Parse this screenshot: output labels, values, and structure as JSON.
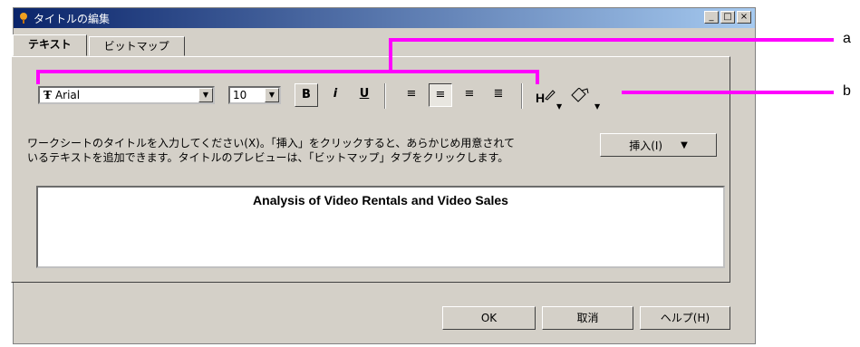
{
  "window": {
    "title": "タイトルの編集",
    "buttons": {
      "minimize": "_",
      "maximize": "□",
      "close": "×"
    }
  },
  "tabs": [
    {
      "label": "テキスト",
      "active": true
    },
    {
      "label": "ビットマップ",
      "active": false
    }
  ],
  "toolbar": {
    "font": "Arial",
    "size": "10",
    "bold": "B",
    "italic": "i",
    "underline": "U",
    "align_left": "≡",
    "align_center": "≡",
    "align_right": "≡",
    "justify": "≣"
  },
  "instruction_line1": "ワークシートのタイトルを入力してください(X)。「挿入」をクリックすると、あらかじめ用意されて",
  "instruction_line2": "いるテキストを追加できます。タイトルのプレビューは、「ビットマップ」タブをクリックします。",
  "insert_button": "挿入(I)",
  "title_text": "Analysis of Video Rentals and Video Sales",
  "footer": {
    "ok": "OK",
    "cancel": "取消",
    "help": "ヘルプ(H)"
  },
  "annotations": {
    "a": "a",
    "b": "b",
    "callout_color": "#ff00ff"
  }
}
